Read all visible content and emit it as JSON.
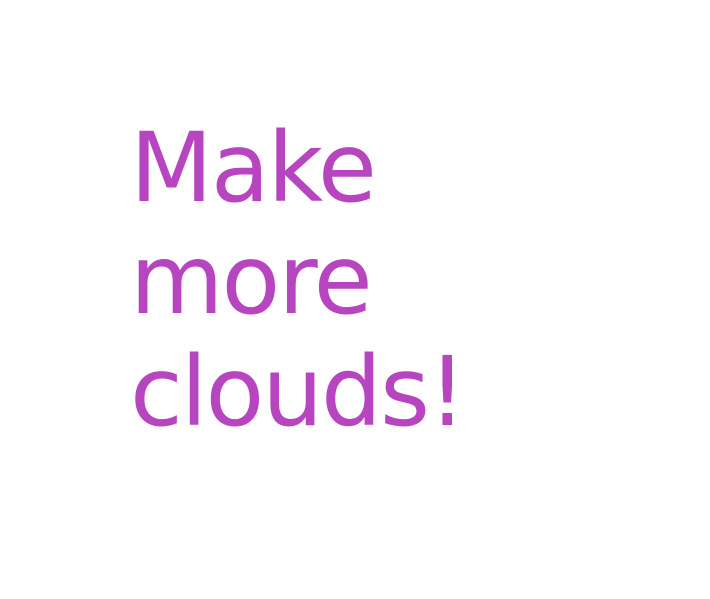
{
  "drawing": {
    "handwritten_text": "Make more clouds!",
    "lines": [
      "Make",
      "more",
      "clouds!"
    ],
    "ink_color": "#b845c0",
    "background_color": "#ffffff"
  }
}
